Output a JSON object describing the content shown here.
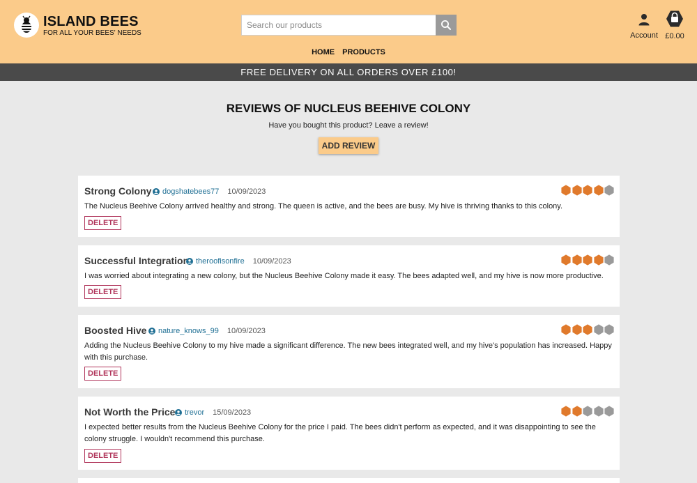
{
  "header": {
    "brand": "ISLAND BEES",
    "tagline": "FOR ALL YOUR BEES' NEEDS",
    "search_placeholder": "Search our products",
    "account_label": "Account",
    "basket_total": "£0.00",
    "bg_color": "#fbcb8a"
  },
  "nav": {
    "items": [
      "HOME",
      "PRODUCTS"
    ]
  },
  "banner": {
    "text": "FREE DELIVERY ON ALL ORDERS OVER £100!"
  },
  "main": {
    "title": "REVIEWS OF NUCLEUS BEEHIVE COLONY",
    "subtitle": "Have you bought this product? Leave a review!",
    "add_review_label": "ADD REVIEW"
  },
  "reviews": [
    {
      "title": "Strong Colony",
      "username": "dogshatebees77",
      "date": "10/09/2023",
      "body": "The Nucleus Beehive Colony arrived healthy and strong. The queen is active, and the bees are busy. My hive is thriving thanks to this colony.",
      "rating": 4,
      "delete_label": "DELETE"
    },
    {
      "title": "Successful Integration",
      "username": "theroofisonfire",
      "date": "10/09/2023",
      "body": "I was worried about integrating a new colony, but the Nucleus Beehive Colony made it easy. The bees adapted well, and my hive is now more productive.",
      "rating": 4,
      "delete_label": "DELETE"
    },
    {
      "title": "Boosted Hive",
      "username": "nature_knows_99",
      "date": "10/09/2023",
      "body": "Adding the Nucleus Beehive Colony to my hive made a significant difference. The new bees integrated well, and my hive's population has increased. Happy with this purchase.",
      "rating": 3,
      "delete_label": "DELETE"
    },
    {
      "title": "Not Worth the Price",
      "username": "trevor",
      "date": "15/09/2023",
      "body": "I expected better results from the Nucleus Beehive Colony for the price I paid. The bees didn't perform as expected, and it was disappointing to see the colony struggle. I wouldn't recommend this purchase.",
      "rating": 2,
      "delete_label": "DELETE"
    }
  ],
  "rating_max": 5,
  "colors": {
    "rating_filled": "#e07a2c",
    "rating_empty": "#9a9a9a",
    "username": "#1f6f94",
    "delete": "#b0345a",
    "banner": "#4a4a4a"
  }
}
